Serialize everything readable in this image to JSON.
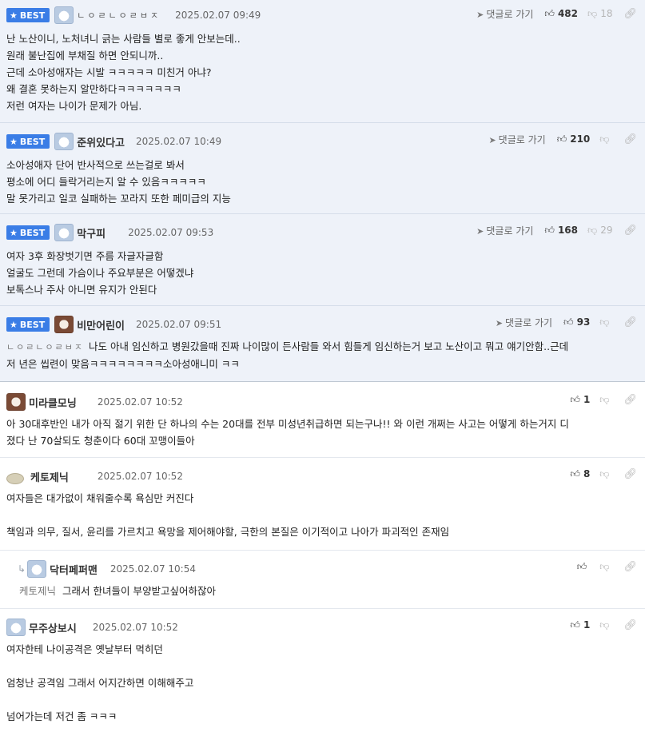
{
  "ui": {
    "best_label": "BEST",
    "reply_label": "댓글로 가기"
  },
  "comments": [
    {
      "nick": "ㄴㅇㄹㄴㅇㄹㅂㅈ",
      "date": "2025.02.07 09:49",
      "up": "482",
      "down": "18",
      "lines": [
        "난 노산이니, 노처녀니 긁는 사람들 별로 좋게 안보는데..",
        "원래 불난집에 부채질 하면 안되니까..",
        "근데 소아성애자는 시발 ㅋㅋㅋㅋㅋ 미친거 아냐?",
        "왜 결혼 못하는지 알만하다ㅋㅋㅋㅋㅋㅋㅋ",
        "저런 여자는 나이가 문제가 아님."
      ]
    },
    {
      "nick": "준위있다고",
      "date": "2025.02.07 10:49",
      "up": "210",
      "down": "",
      "lines": [
        "소아성애자 단어 반사적으로 쓰는걸로 봐서",
        "평소에 어디 들락거리는지 알 수 있음ㅋㅋㅋㅋㅋ",
        "말 못가리고 일코 실패하는 꼬라지 또한 페미급의 지능"
      ]
    },
    {
      "nick": "막구피",
      "date": "2025.02.07 09:53",
      "up": "168",
      "down": "29",
      "lines": [
        "여자 3후 화장벗기면 주름 자글자글함",
        "얼굴도 그런데 가슴이나 주요부분은 어떻겠냐",
        "보톡스나 주사 아니면 유지가 안된다"
      ]
    },
    {
      "nick": "비만어린이",
      "date": "2025.02.07 09:51",
      "up": "93",
      "down": "",
      "mention": "ㄴㅇㄹㄴㅇㄹㅂㅈ",
      "first_line": "나도 아내 임신하고 병원갔을때 진짜 나이많이 든사람들 와서 힘들게 임신하는거 보고 노산이고 뭐고 얘기안함..근데",
      "lines": [
        "저 년은 씹련이 맞음ㅋㅋㅋㅋㅋㅋㅋㅋ소아성애니미 ㅋㅋ"
      ]
    },
    {
      "nick": "미라클모닝",
      "date": "2025.02.07 10:52",
      "up": "1",
      "lines": [
        "아 30대후반인 내가 아직 젊기 위한 단 하나의 수는 20대를 전부 미성년취급하면 되는구나!! 와 이런 개쩌는 사고는 어떻게 하는거지 디",
        "졌다 난 70살되도 청춘이다 60대 꼬맹이들아"
      ]
    },
    {
      "nick": "케토제닉",
      "date": "2025.02.07 10:52",
      "up": "8",
      "lines": [
        "여자들은 대가없이 채워줄수록 욕심만 커진다",
        "",
        "책임과 의무, 질서, 윤리를 가르치고 욕망을 제어해야할, 극한의 본질은 이기적이고 나아가 파괴적인 존재임"
      ]
    },
    {
      "nick": "닥터페퍼맨",
      "date": "2025.02.07 10:54",
      "up": "",
      "mention": "케토제닉",
      "first_line": "그래서 한녀들이 부양받고싶어하잖아"
    },
    {
      "nick": "무주상보시",
      "date": "2025.02.07 10:52",
      "up": "1",
      "lines": [
        "여자한테 나이공격은 옛날부터 먹히던",
        "",
        "엄청난 공격임 그래서 어지간하면 이해해주고",
        "",
        "넘어가는데 저건 좀 ㅋㅋㅋ"
      ]
    }
  ]
}
